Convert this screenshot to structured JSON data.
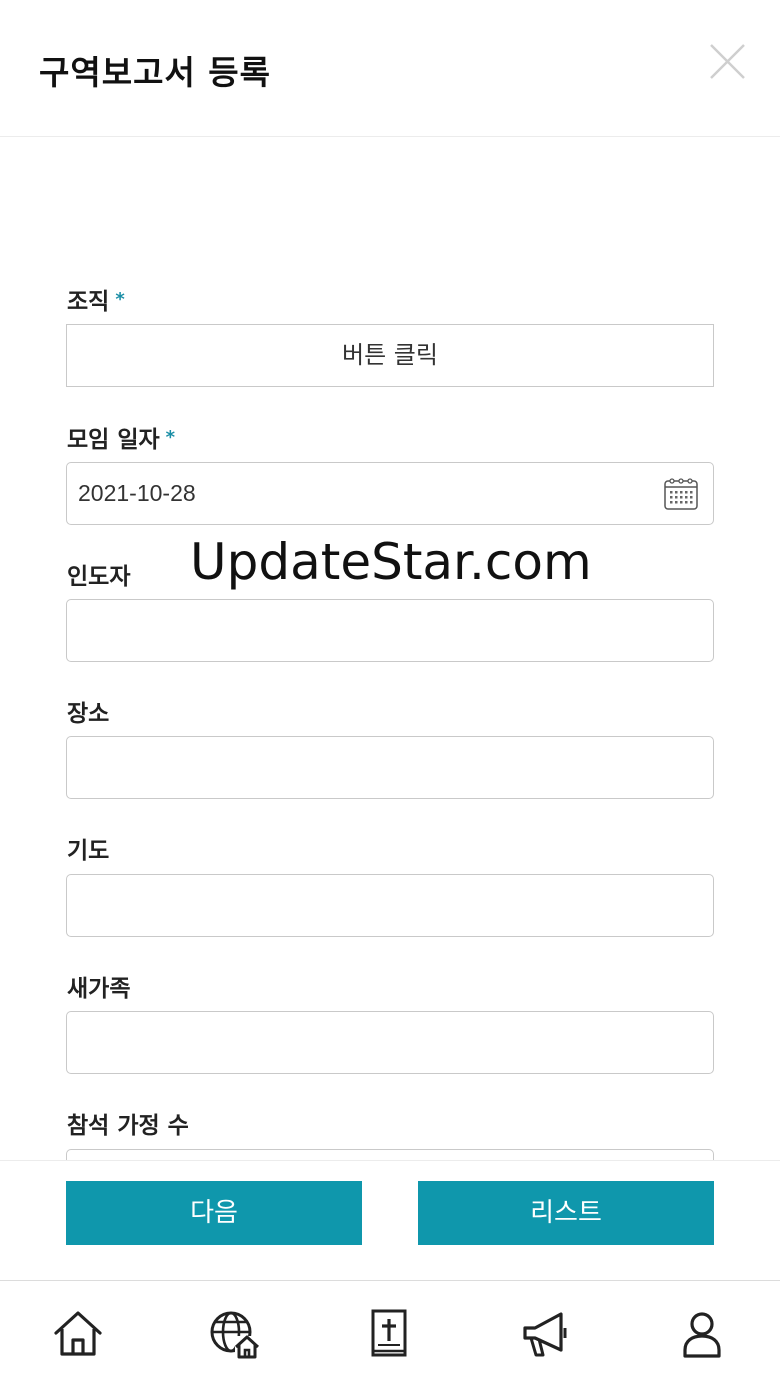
{
  "header": {
    "title": "구역보고서 등록",
    "close_icon": "close-icon"
  },
  "form": {
    "fields": [
      {
        "label": "조직",
        "required": true,
        "type": "button",
        "value": "버튼 클릭"
      },
      {
        "label": "모임 일자",
        "required": true,
        "type": "date",
        "value": "2021-10-28"
      },
      {
        "label": "인도자",
        "required": false,
        "type": "text",
        "value": ""
      },
      {
        "label": "장소",
        "required": false,
        "type": "text",
        "value": ""
      },
      {
        "label": "기도",
        "required": false,
        "type": "text",
        "value": ""
      },
      {
        "label": "새가족",
        "required": false,
        "type": "text",
        "value": ""
      },
      {
        "label": "참석 가정 수",
        "required": false,
        "type": "text",
        "value": ""
      }
    ],
    "required_mark": "*"
  },
  "watermark": "UpdateStar.com",
  "actions": {
    "next_label": "다음",
    "list_label": "리스트"
  },
  "bottom_nav": {
    "items": [
      "home-icon",
      "church-globe-icon",
      "bible-icon",
      "megaphone-icon",
      "user-icon"
    ]
  },
  "colors": {
    "accent": "#0f97ac",
    "required": "#1a8ea6"
  }
}
